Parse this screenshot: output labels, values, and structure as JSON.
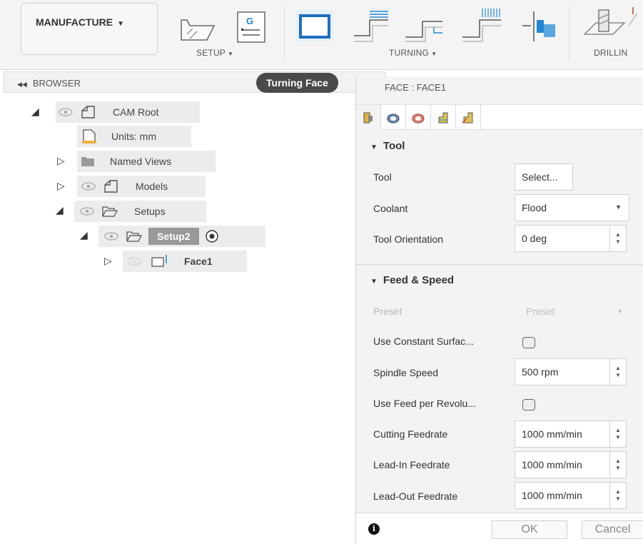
{
  "toolbar": {
    "workspace_label": "MANUFACTURE",
    "groups": {
      "setup": "SETUP",
      "turning": "TURNING",
      "drilling": "DRILLIN"
    }
  },
  "browser": {
    "header": "BROWSER",
    "tooltip": "Turning Face",
    "tree": {
      "cam_root": "CAM Root",
      "units": "Units: mm",
      "named_views": "Named Views",
      "models": "Models",
      "setups": "Setups",
      "setup2": "Setup2",
      "face1": "Face1"
    }
  },
  "dialog": {
    "title": "FACE : FACE1",
    "tool_section": {
      "header": "Tool",
      "tool_label": "Tool",
      "tool_value": "Select...",
      "coolant_label": "Coolant",
      "coolant_value": "Flood",
      "orientation_label": "Tool Orientation",
      "orientation_value": "0 deg"
    },
    "feed_section": {
      "header": "Feed & Speed",
      "preset_label": "Preset",
      "preset_value": "Preset",
      "css_label": "Use Constant Surfac...",
      "spindle_label": "Spindle Speed",
      "spindle_value": "500 rpm",
      "feed_rev_label": "Use Feed per Revolu...",
      "cutting_label": "Cutting Feedrate",
      "cutting_value": "1000 mm/min",
      "leadin_label": "Lead-In Feedrate",
      "leadin_value": "1000 mm/min",
      "leadout_label": "Lead-Out Feedrate",
      "leadout_value": "1000 mm/min"
    },
    "footer": {
      "ok": "OK",
      "cancel": "Cancel"
    }
  },
  "colors": {
    "accent": "#1e88d8",
    "setup_active": "#999999"
  }
}
